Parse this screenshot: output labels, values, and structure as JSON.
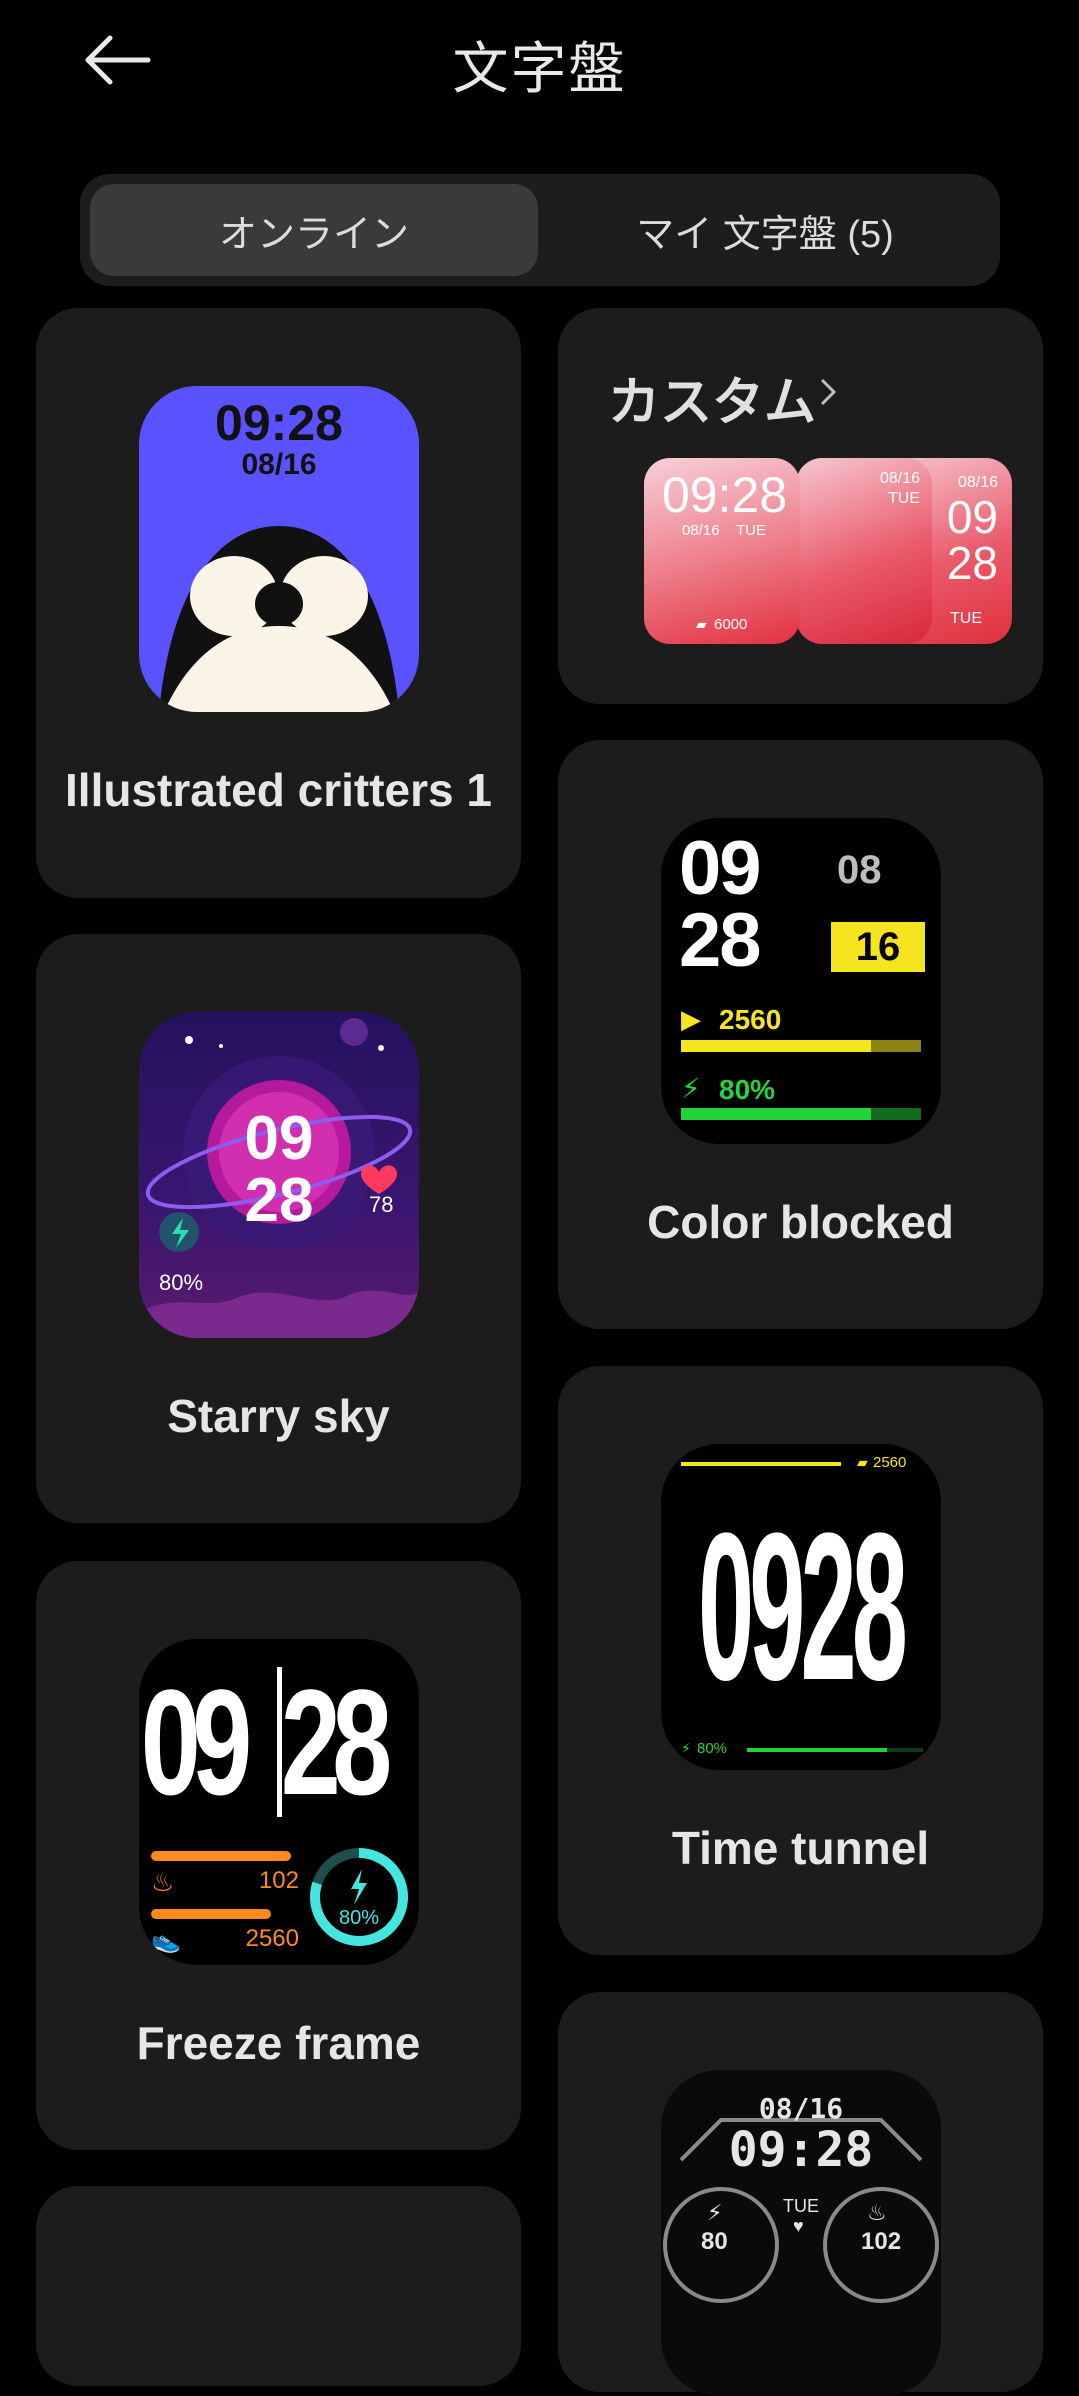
{
  "header": {
    "title": "文字盤",
    "back_icon": "arrow-left-icon"
  },
  "tabs": [
    {
      "label": "オンライン",
      "active": true
    },
    {
      "label": "マイ 文字盤 (5)",
      "active": false
    }
  ],
  "left_column": [
    {
      "name": "Illustrated critters 1",
      "time": "09:28",
      "date": "08/16"
    },
    {
      "name": "Starry sky",
      "hour": "09",
      "minute": "28",
      "heart": "78",
      "battery": "80%"
    },
    {
      "name": "Freeze frame",
      "hour": "09",
      "minute": "28",
      "calories": "102",
      "steps": "2560",
      "battery": "80%"
    }
  ],
  "right_column": [
    {
      "name": "カスタム",
      "chevron_icon": "chevron-right-icon",
      "time": "09:28",
      "date": "08/16",
      "weekday": "TUE",
      "steps": "6000",
      "back_date": "08/16",
      "back_weekday": "TUE",
      "back_hour": "09",
      "back_minute": "28"
    },
    {
      "name": "Color blocked",
      "hour": "09",
      "minute": "28",
      "month": "08",
      "day": "16",
      "steps": "2560",
      "battery": "80%"
    },
    {
      "name": "Time tunnel",
      "digits": "0928",
      "steps": "2560",
      "battery": "80%"
    },
    {
      "name": "",
      "date": "08/16",
      "time": "09:28",
      "weekday": "TUE",
      "battery": "80",
      "calories": "102"
    }
  ],
  "colors": {
    "background": "#000000",
    "card": "#1c1c1c",
    "accent_yellow": "#f5e51e",
    "accent_green": "#22d43a",
    "accent_orange": "#ff8a1e"
  }
}
